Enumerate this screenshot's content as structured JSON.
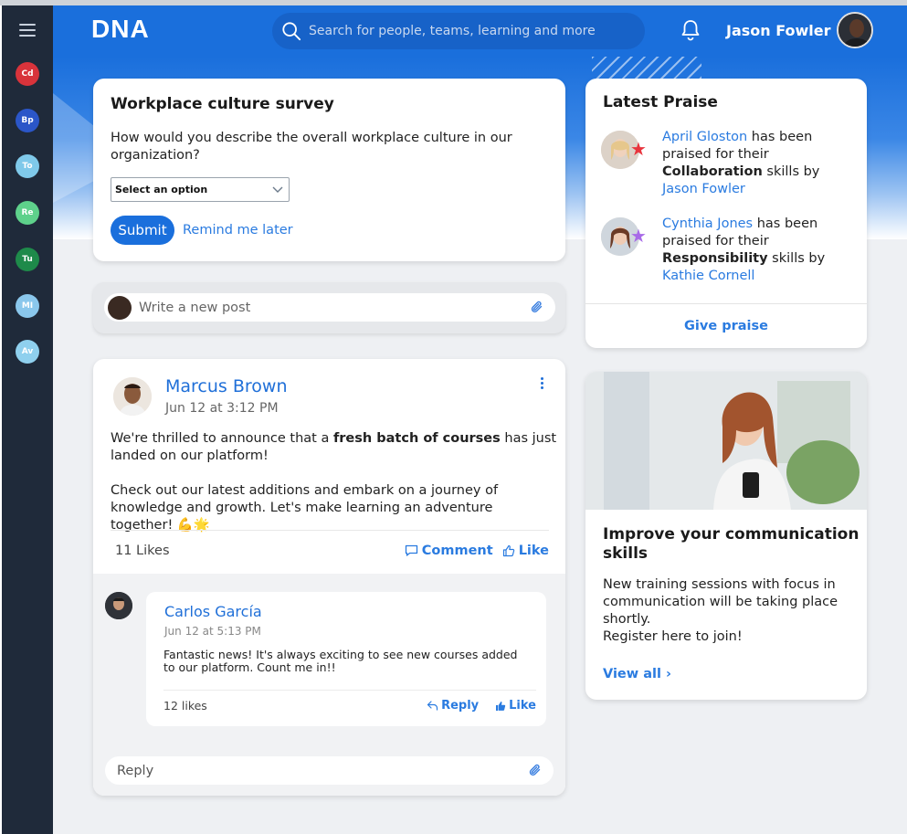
{
  "app": {
    "logo": "DNA"
  },
  "sidebar": {
    "teams": [
      {
        "label": "Cd",
        "color": "#d8333b"
      },
      {
        "label": "Bp",
        "color": "#2b56c8"
      },
      {
        "label": "To",
        "color": "#7fc9ea"
      },
      {
        "label": "Re",
        "color": "#5ed18b"
      },
      {
        "label": "Tu",
        "color": "#1e8a4a"
      },
      {
        "label": "MI",
        "color": "#8ac7ec"
      },
      {
        "label": "Av",
        "color": "#8fd0ee"
      }
    ]
  },
  "header": {
    "search_placeholder": "Search for people, teams, learning and more",
    "user_name": "Jason Fowler"
  },
  "survey": {
    "title": "Workplace culture survey",
    "question": "How would you describe the overall workplace culture in our organization?",
    "select_value": "Select an option",
    "submit_label": "Submit",
    "remind_label": "Remind me later"
  },
  "composer": {
    "placeholder": "Write a new post"
  },
  "post": {
    "author": "Marcus Brown",
    "date": "Jun 12 at 3:12 PM",
    "body_intro": "We're thrilled to announce that a ",
    "body_bold": "fresh batch of courses",
    "body_rest": " has just landed on our platform!",
    "body_p2": "Check out our latest additions and embark on a journey of knowledge and growth. Let's make learning an adventure together! 💪🌟",
    "likes": "11 Likes",
    "comment_label": "Comment",
    "like_label": "Like",
    "reply_placeholder": "Reply",
    "comment": {
      "author": "Carlos García",
      "date": "Jun 12 at 5:13 PM",
      "text": "Fantastic news! It's always exciting to see new courses added to our platform. Count me in!!",
      "likes": "12 likes",
      "reply_label": "Reply",
      "like_label": "Like"
    }
  },
  "praise": {
    "title": "Latest Praise",
    "items": [
      {
        "person": "April Gloston",
        "pre": " has been praised for their ",
        "skill": "Collaboration",
        "mid": " skills by ",
        "by": "Jason Fowler",
        "star_color": "#e8343d"
      },
      {
        "person": "Cynthia Jones",
        "pre": " has been praised for their ",
        "skill": "Responsibility",
        "mid": " skills by ",
        "by": "Kathie Cornell",
        "star_color": "#a86ae8"
      }
    ],
    "give_label": "Give praise"
  },
  "promo": {
    "title": "Improve your communication skills",
    "body": "New training sessions with focus in communication will be taking place shortly.",
    "body2": "Register here to join!",
    "link": "View all"
  }
}
